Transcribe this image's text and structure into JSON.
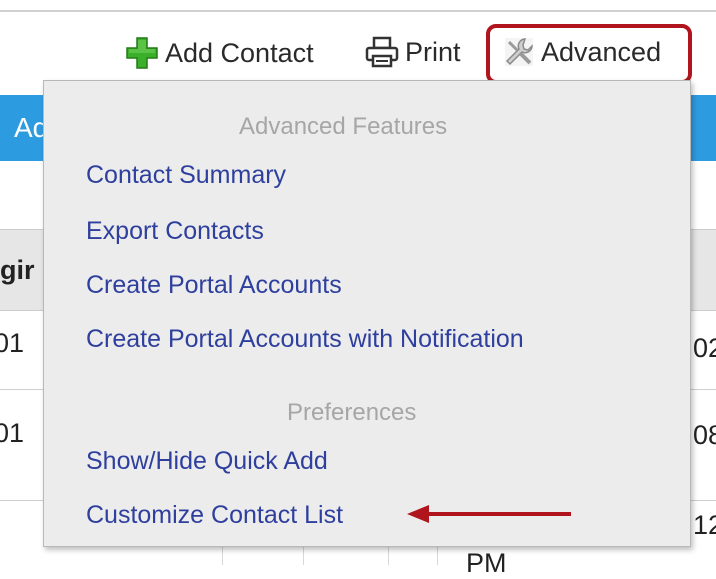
{
  "toolbar": {
    "add_contact_label": "Add Contact",
    "print_label": "Print",
    "advanced_label": "Advanced"
  },
  "background": {
    "blue_bar_fragment": "Ad",
    "header_fragment": "gir",
    "row1_left": "01",
    "row1_right": "02",
    "row2_left": "01",
    "row2_right": "08",
    "row3_right": "12",
    "row4_fragment": "PM"
  },
  "dropdown": {
    "advanced_section": "Advanced Features",
    "advanced_items": [
      {
        "label": "Contact Summary"
      },
      {
        "label": "Export Contacts"
      },
      {
        "label": "Create Portal Accounts"
      },
      {
        "label": "Create Portal Accounts with Notification"
      }
    ],
    "preferences_section": "Preferences",
    "preferences_items": [
      {
        "label": "Show/Hide Quick Add"
      },
      {
        "label": "Customize Contact List"
      }
    ]
  },
  "colors": {
    "menu_link": "#2e3f9e",
    "section_header": "#a6a6a6",
    "annotation_red": "#b0141c",
    "blue_bar": "#2d9be0",
    "add_icon_green": "#3ab02a"
  },
  "icons": [
    "plus-icon",
    "printer-icon",
    "wrench-icon",
    "arrow-icon"
  ]
}
